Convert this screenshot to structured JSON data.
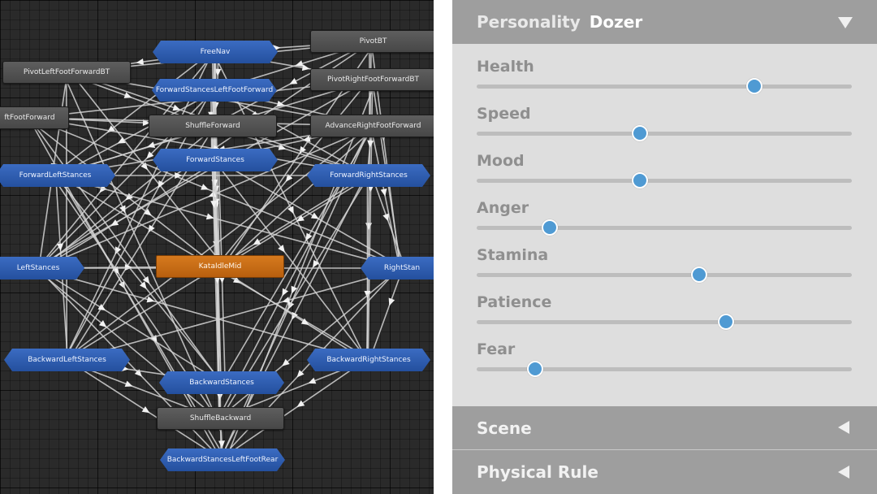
{
  "graph": {
    "states": [
      {
        "id": "freenav",
        "label": "FreeNav",
        "style": "blue"
      },
      {
        "id": "pivotbt",
        "label": "PivotBT",
        "style": "gray"
      },
      {
        "id": "pivotleftfootforwardbt",
        "label": "PivotLeftFootForwardBT",
        "style": "gray"
      },
      {
        "id": "forwardstancesleftfootforward",
        "label": "ForwardStancesLeftFootForward",
        "style": "blue"
      },
      {
        "id": "pivotrightfootforwardbt",
        "label": "PivotRightFootForwardBT",
        "style": "gray"
      },
      {
        "id": "leftfootforward",
        "label": "ftFootForward",
        "style": "gray"
      },
      {
        "id": "shuffleforward",
        "label": "ShuffleForward",
        "style": "gray"
      },
      {
        "id": "advancerightfootforward",
        "label": "AdvanceRightFootForward",
        "style": "gray"
      },
      {
        "id": "forwardstances",
        "label": "ForwardStances",
        "style": "blue"
      },
      {
        "id": "forwardleftstances",
        "label": "ForwardLeftStances",
        "style": "blue"
      },
      {
        "id": "forwardrightstances",
        "label": "ForwardRightStances",
        "style": "blue"
      },
      {
        "id": "leftstances",
        "label": "LeftStances",
        "style": "blue"
      },
      {
        "id": "kataidlemid",
        "label": "KataIdleMid",
        "style": "orange"
      },
      {
        "id": "rightstances",
        "label": "RightStan",
        "style": "blue"
      },
      {
        "id": "backwardleftstances",
        "label": "BackwardLeftStances",
        "style": "blue"
      },
      {
        "id": "backwardrightstances",
        "label": "BackwardRightStances",
        "style": "blue"
      },
      {
        "id": "backwardstances",
        "label": "BackwardStances",
        "style": "blue"
      },
      {
        "id": "shufflebackward",
        "label": "ShuffleBackward",
        "style": "gray"
      },
      {
        "id": "backwardstancesleftfootrear",
        "label": "BackwardStancesLeftFootRear",
        "style": "blue"
      }
    ]
  },
  "panel": {
    "personality": {
      "title": "Personality",
      "value": "Dozer",
      "icon": "triangle-down-icon"
    },
    "sliders": [
      {
        "label": "Health",
        "value": 0.74
      },
      {
        "label": "Speed",
        "value": 0.435
      },
      {
        "label": "Mood",
        "value": 0.435
      },
      {
        "label": "Anger",
        "value": 0.195
      },
      {
        "label": "Stamina",
        "value": 0.593
      },
      {
        "label": "Patience",
        "value": 0.665
      },
      {
        "label": "Fear",
        "value": 0.155
      }
    ],
    "scene": {
      "title": "Scene",
      "icon": "triangle-left-icon"
    },
    "physical_rule": {
      "title": "Physical Rule",
      "icon": "triangle-left-icon"
    }
  },
  "colors": {
    "graph_background": "#2a2a2a",
    "state_blue": "#2d5bb0",
    "state_gray": "#525252",
    "state_orange": "#c96d15",
    "panel_background": "#dedede",
    "panel_header": "#9e9e9e",
    "slider_track": "#bdbdbd",
    "slider_thumb": "#4f9ad3"
  }
}
